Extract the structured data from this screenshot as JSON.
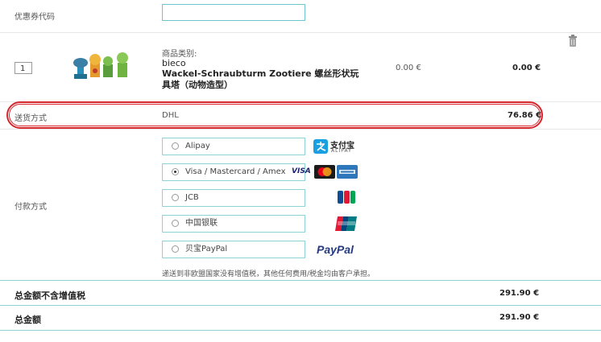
{
  "coupon": {
    "label": "优惠券代码",
    "value": ""
  },
  "cart_item": {
    "quantity": "1",
    "category_label": "商品类别:",
    "brand": "bieco",
    "name": "Wackel-Schraubturm Zootiere 螺丝形状玩具塔（动物造型）",
    "unit_price": "0.00 €",
    "total_price": "0.00 €"
  },
  "shipping": {
    "label": "送货方式",
    "method": "DHL",
    "price": "76.86 €"
  },
  "payment": {
    "label": "付款方式",
    "options": [
      {
        "label": "Alipay",
        "selected": false,
        "logo": "alipay-logo",
        "logo_text": "支付宝",
        "logo_subtext": "ALIPAY"
      },
      {
        "label": "Visa / Mastercard / Amex",
        "selected": true,
        "logo": "cards-logo",
        "logo_text": "VISA"
      },
      {
        "label": "JCB",
        "selected": false,
        "logo": "jcb-logo"
      },
      {
        "label": "中国银联",
        "selected": false,
        "logo": "unionpay-logo"
      },
      {
        "label": "贝宝PayPal",
        "selected": false,
        "logo": "paypal-logo",
        "logo_text": "PayPal"
      }
    ],
    "note": "递送到非欧盟国家没有增值税，其他任何费用/税金均由客户承担。"
  },
  "totals": {
    "net_label": "总金额不含增值税",
    "net_value": "291.90 €",
    "gross_label": "总金额",
    "gross_value": "291.90 €"
  },
  "colors": {
    "accent": "#6ec6cc",
    "highlight": "#d6262c",
    "alipay": "#1a9fe0",
    "paypal": "#253b80"
  }
}
